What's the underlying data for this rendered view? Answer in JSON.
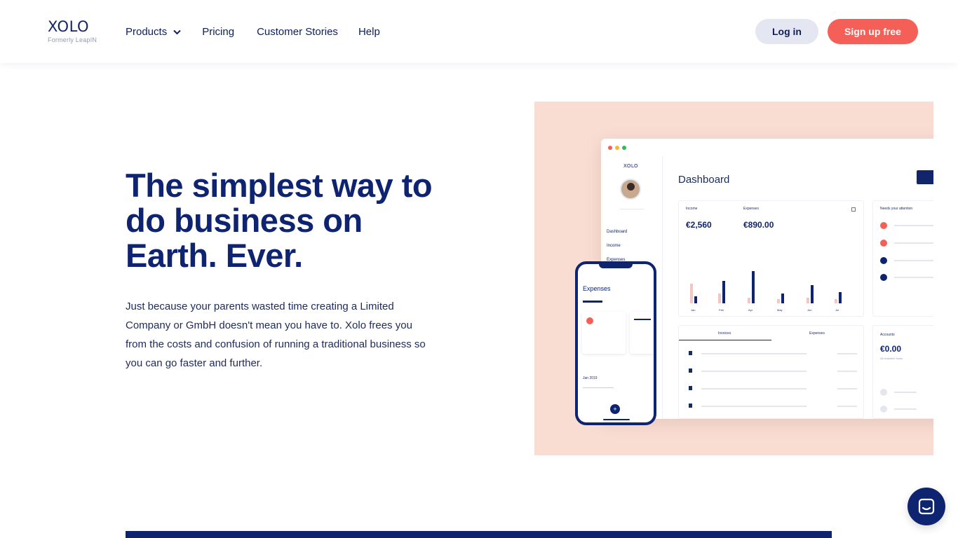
{
  "header": {
    "logo_word": "XOLO",
    "logo_sub": "Formerly LeapIN",
    "nav": [
      {
        "label": "Products"
      },
      {
        "label": "Pricing"
      },
      {
        "label": "Customer Stories"
      },
      {
        "label": "Help"
      }
    ],
    "login_label": "Log in",
    "signup_label": "Sign up free"
  },
  "hero": {
    "title": "The simplest way to do business on Earth. Ever.",
    "description": "Just because your parents wasted time creating a Limited Company or GmbH doesn't mean you have to. Xolo frees you from the costs and confusion of running a traditional business so you can go faster and further."
  },
  "illustration": {
    "mini_logo": "XOLO",
    "side_menu": [
      "Dashboard",
      "Income",
      "Expenses"
    ],
    "dashboard_title": "Dashboard",
    "income_label": "Income",
    "income_value": "€2,560",
    "expenses_label": "Expenses",
    "expenses_value": "€890.00",
    "attention_label": "Needs your attention",
    "months": [
      "Jan",
      "Feb",
      "Apr",
      "May",
      "Jun",
      "Jul"
    ],
    "tab_invoices": "Invoices",
    "tab_expenses": "Expenses",
    "accounts_label": "Accounts",
    "accounts_value": "€0.00",
    "accounts_sub": "All available funds",
    "phone_title": "Expenses",
    "phone_date": "Jan 2019"
  },
  "colors": {
    "brand_navy": "#0e2470",
    "signup_red": "#f45f57",
    "illustration_bg": "#f9ddd3"
  }
}
